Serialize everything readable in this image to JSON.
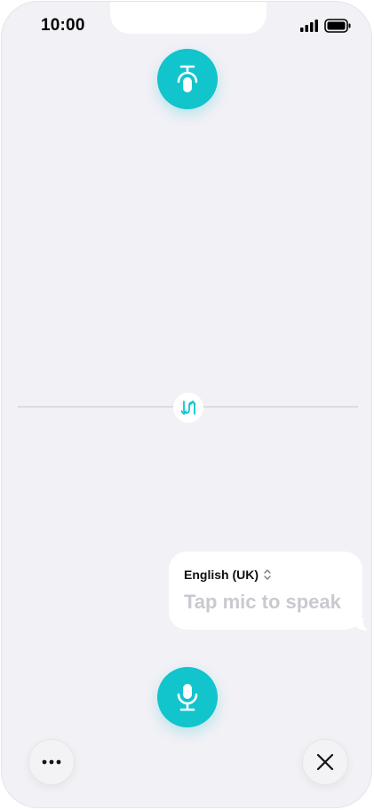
{
  "status_bar": {
    "time": "10:00"
  },
  "icons": {
    "top_mic": "mic-upside-down-icon",
    "bottom_mic": "mic-icon",
    "swap": "swap-arrows-icon",
    "more": "more-dots-icon",
    "close": "close-icon",
    "signal": "signal-bars-icon",
    "battery": "battery-icon",
    "language_select": "chevron-up-down-icon"
  },
  "bubble": {
    "language": "English (UK)",
    "prompt": "Tap mic to speak"
  },
  "colors": {
    "accent": "#12c4cc",
    "background": "#f1f1f6",
    "prompt_text": "#c9c9cf"
  }
}
